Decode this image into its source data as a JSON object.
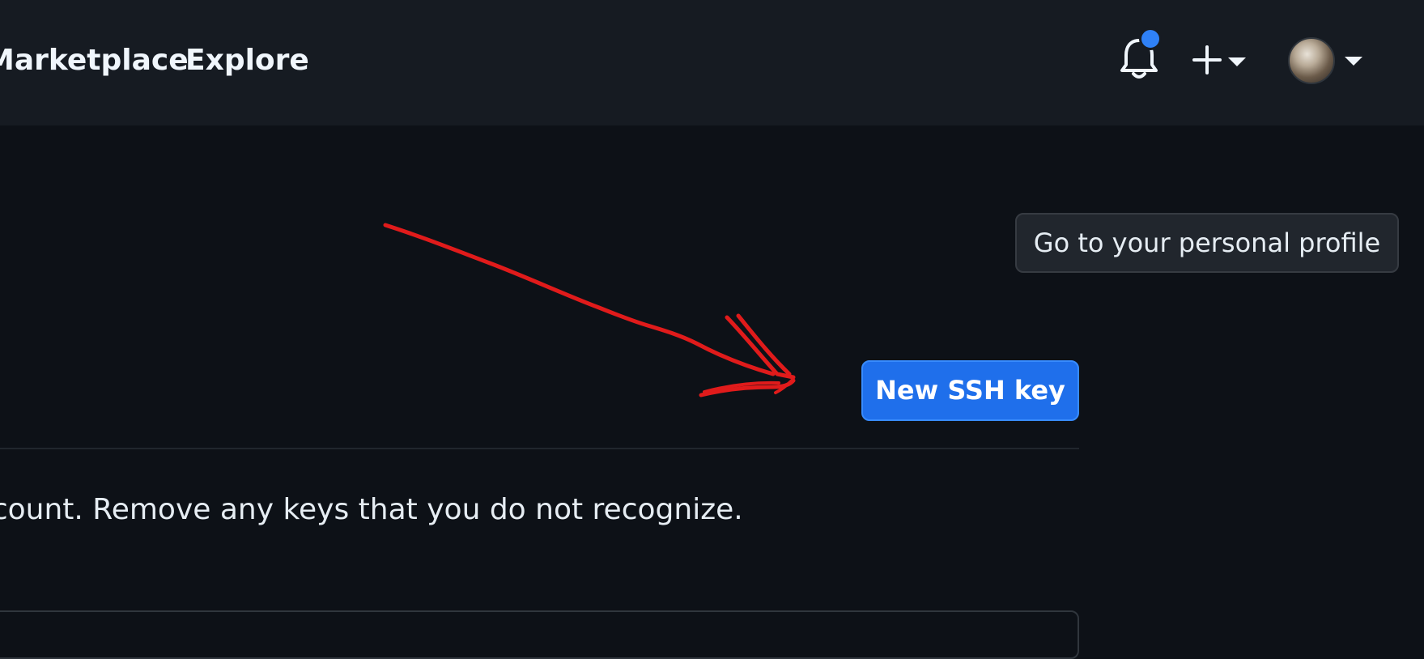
{
  "header": {
    "nav": [
      {
        "label": "Marketplace"
      },
      {
        "label": "Explore"
      }
    ],
    "notifications": {
      "icon": "bell-icon",
      "unread": true,
      "dot_color": "#2f81f7"
    },
    "create_menu": {
      "icon": "plus-icon",
      "caret_icon": "caret-down-icon"
    },
    "user_menu": {
      "avatar": "user-avatar",
      "caret_icon": "caret-down-icon"
    }
  },
  "profile_button": {
    "label": "Go to your personal profile"
  },
  "ssh": {
    "new_key_label": "New SSH key",
    "description": "account. Remove any keys that you do not recognize."
  },
  "annotation": {
    "type": "hand-drawn-arrow",
    "color": "#e01b1b",
    "points_to": "New SSH key"
  },
  "colors": {
    "page_bg": "#0d1117",
    "header_bg": "#161b22",
    "primary_button": "#1f6feb",
    "text": "#e6edf3"
  }
}
